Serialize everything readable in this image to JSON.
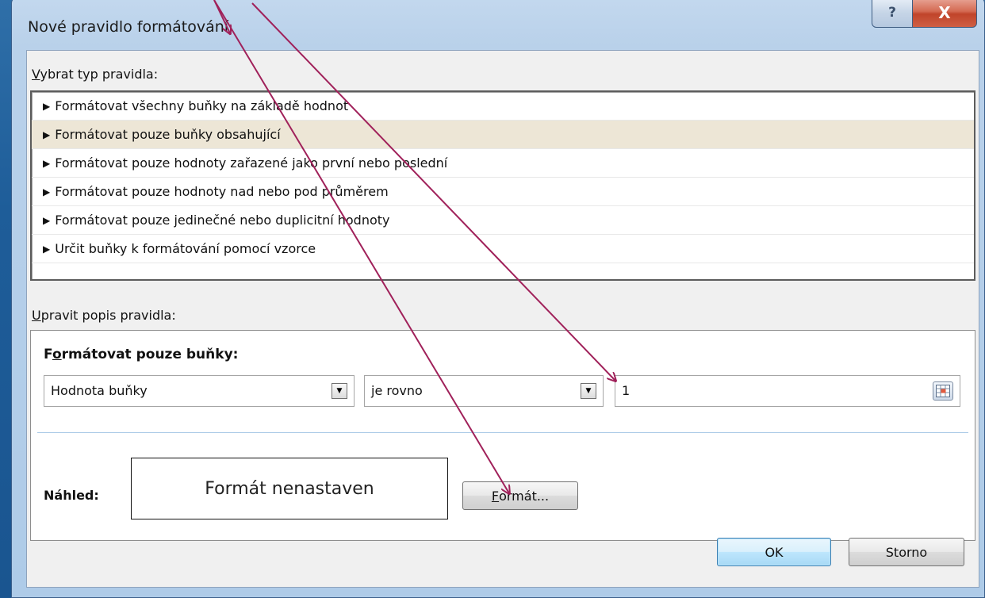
{
  "window": {
    "title": "Nové pravidlo formátování",
    "help_label": "?",
    "close_label": "X"
  },
  "rule_type": {
    "label_first": "V",
    "label_rest": "ybrat typ pravidla:",
    "items": [
      {
        "label": "Formátovat všechny buňky na základě hodnot",
        "selected": false
      },
      {
        "label": "Formátovat pouze buňky obsahující",
        "selected": true
      },
      {
        "label": "Formátovat pouze hodnoty zařazené jako první nebo poslední",
        "selected": false
      },
      {
        "label": "Formátovat pouze hodnoty nad nebo pod průměrem",
        "selected": false
      },
      {
        "label": "Formátovat pouze jedinečné nebo duplicitní hodnoty",
        "selected": false
      },
      {
        "label": "Určit buňky k formátování pomocí vzorce",
        "selected": false
      }
    ]
  },
  "rule_description": {
    "label_first": "U",
    "label_rest": "pravit popis pravidla:",
    "heading_a": "F",
    "heading_b": "o",
    "heading_c": "rmátovat pouze buňky:",
    "condition_type": "Hodnota buňky",
    "operator": "je rovno",
    "value": "1",
    "preview_label": "Náhled:",
    "preview_text": "Formát nenastaven",
    "format_button_first": "F",
    "format_button_rest": "ormát..."
  },
  "buttons": {
    "ok": "OK",
    "cancel": "Storno"
  },
  "icons": {
    "list_bullet": "triangle-right-icon",
    "dropdown": "chevron-down-icon",
    "range_picker": "collapse-dialog-icon"
  },
  "colors": {
    "annotation_arrow": "#a0215a",
    "selected_row": "#ede6d6"
  }
}
